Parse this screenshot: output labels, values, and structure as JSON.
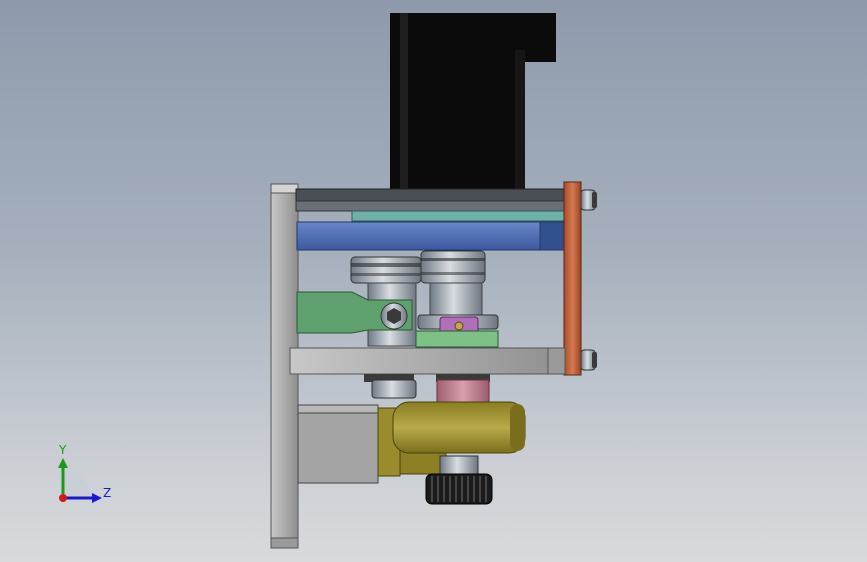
{
  "viewport": {
    "background_top": "#8e9aac",
    "background_bottom": "#d9dadc"
  },
  "triad": {
    "y_label": "Y",
    "z_label": "Z",
    "colors": {
      "y": "#1a9a1a",
      "z": "#1a1ad0",
      "x": "#d01a1a"
    }
  },
  "model": {
    "colors": {
      "motor": "#0b0b0b",
      "frame_gray": "#a9a9a9",
      "top_plate": "#4a4f55",
      "teal_plate": "#6fb0a8",
      "blue_plate": "#4f6fb5",
      "green_bracket": "#5fa06f",
      "orange_bracket": "#c0633e",
      "gold_wheel": "#a89a3a",
      "pink_ring": "#c98a98",
      "magenta_collar": "#b070b8"
    }
  }
}
